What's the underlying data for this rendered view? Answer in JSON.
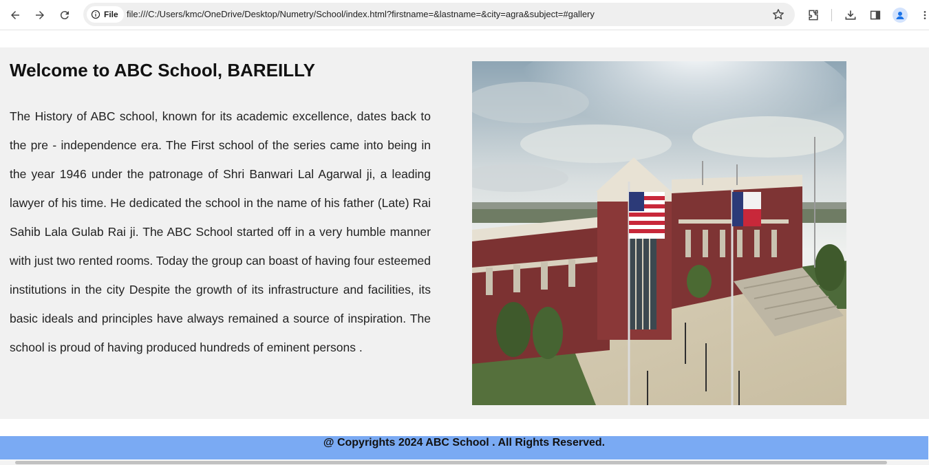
{
  "browser": {
    "site_chip_label": "File",
    "url": "file:///C:/Users/kmc/OneDrive/Desktop/Numetry/School/index.html?firstname=&lastname=&city=agra&subject=#gallery",
    "icons": [
      "back-icon",
      "forward-icon",
      "reload-icon",
      "info-icon",
      "star-icon",
      "extensions-icon",
      "download-icon",
      "side-panel-icon",
      "profile-icon",
      "menu-icon"
    ]
  },
  "main": {
    "title": "Welcome to ABC School, BAREILLY",
    "history": "The History of ABC school, known for its academic excellence, dates back to the pre - independence era. The First school of the series came into being in the year 1946 under the patronage of Shri Banwari Lal Agarwal ji, a leading lawyer of his time. He dedicated the school in the name of his father (Late) Rai Sahib Lala Gulab Rai ji. The ABC School started off in a very humble manner with just two rented rooms. Today the group can boast of having four esteemed institutions in the city Despite the growth of its infrastructure and facilities, its basic ideals and principles have always remained a source of inspiration. The school is proud of having produced hundreds of eminent persons ."
  },
  "footer": {
    "text": "@ Copyrights 2024 ABC School . All Rights Reserved."
  },
  "colors": {
    "hero_bg": "#f1f1f1",
    "footer_bg": "#7aaaf3",
    "accent": "#1a73e8"
  }
}
